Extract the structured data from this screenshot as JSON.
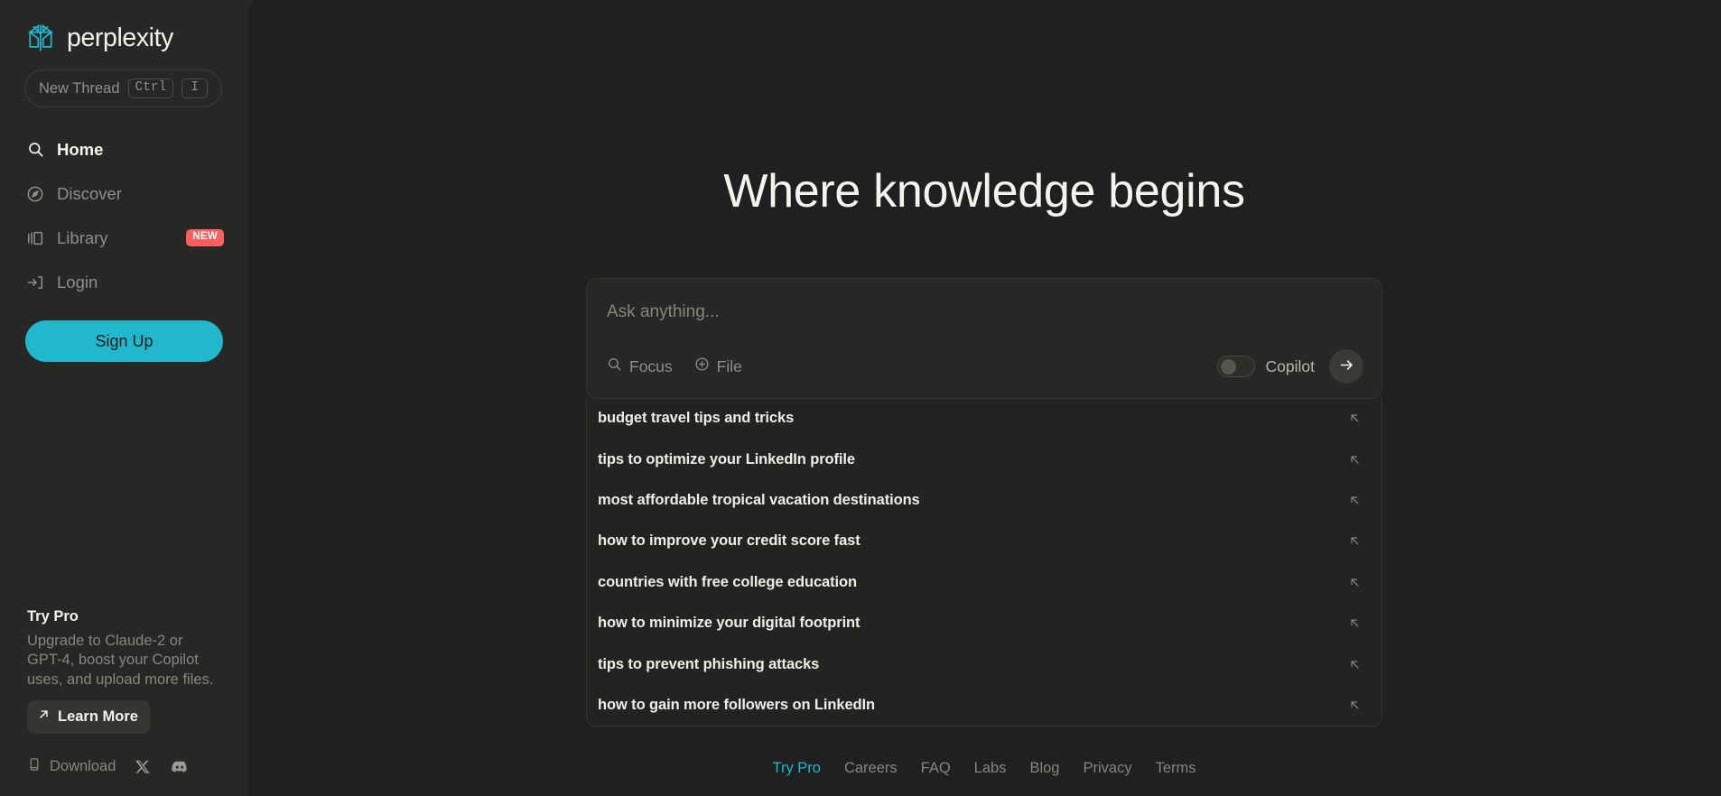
{
  "brand": {
    "name": "perplexity",
    "accent_color": "#21b8cd",
    "logo_icon": "perplexity-logo-mark"
  },
  "sidebar": {
    "new_thread": {
      "label": "New Thread",
      "shortcut_modifier": "Ctrl",
      "shortcut_key": "I"
    },
    "items": [
      {
        "label": "Home",
        "icon": "search-icon",
        "active": true
      },
      {
        "label": "Discover",
        "icon": "compass-icon",
        "active": false
      },
      {
        "label": "Library",
        "icon": "library-icon",
        "active": false,
        "badge": "NEW"
      },
      {
        "label": "Login",
        "icon": "login-arrow-icon",
        "active": false
      }
    ],
    "signup_label": "Sign Up",
    "try_pro": {
      "title": "Try Pro",
      "description": "Upgrade to Claude-2 or GPT-4, boost your Copilot uses, and upload more files.",
      "cta_label": "Learn More",
      "cta_icon": "arrow-up-right-icon"
    },
    "footer": {
      "download_label": "Download",
      "download_icon": "phone-icon",
      "social": [
        {
          "name": "x-twitter-icon"
        },
        {
          "name": "discord-icon"
        }
      ]
    },
    "badge_color": "#ff5e5e"
  },
  "main": {
    "hero_title": "Where knowledge begins",
    "search": {
      "value": "",
      "placeholder": "Ask anything...",
      "focus_label": "Focus",
      "focus_icon": "search-icon",
      "file_label": "File",
      "file_icon": "plus-circle-icon",
      "copilot_label": "Copilot",
      "copilot_enabled": false,
      "submit_icon": "arrow-right-icon"
    },
    "suggestions": [
      {
        "text": "budget travel tips and tricks"
      },
      {
        "text": "tips to optimize your LinkedIn profile"
      },
      {
        "text": "most affordable tropical vacation destinations"
      },
      {
        "text": "how to improve your credit score fast"
      },
      {
        "text": "countries with free college education"
      },
      {
        "text": "how to minimize your digital footprint"
      },
      {
        "text": "tips to prevent phishing attacks"
      },
      {
        "text": "how to gain more followers on LinkedIn"
      }
    ],
    "suggestion_icon": "arrow-up-left-icon",
    "footer_links": [
      {
        "label": "Try Pro",
        "accent": true
      },
      {
        "label": "Careers",
        "accent": false
      },
      {
        "label": "FAQ",
        "accent": false
      },
      {
        "label": "Labs",
        "accent": false
      },
      {
        "label": "Blog",
        "accent": false
      },
      {
        "label": "Privacy",
        "accent": false
      },
      {
        "label": "Terms",
        "accent": false
      }
    ]
  }
}
